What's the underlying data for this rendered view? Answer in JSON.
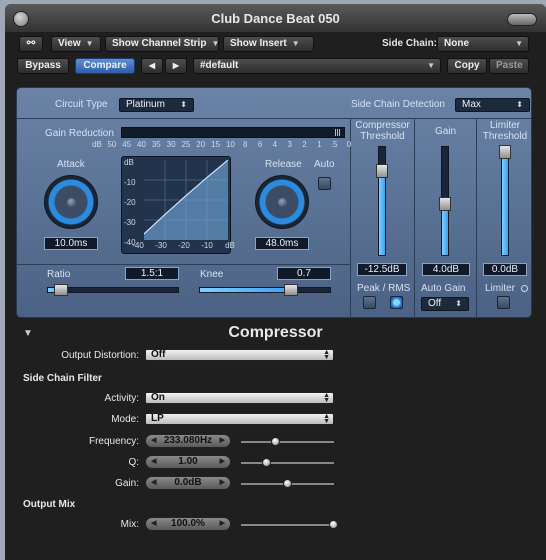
{
  "window": {
    "title": "Club Dance Beat 050"
  },
  "toolbar1": {
    "view": "View",
    "show_channel_strip": "Show Channel Strip",
    "show_insert": "Show Insert",
    "side_chain_label": "Side Chain:",
    "side_chain_value": "None"
  },
  "toolbar2": {
    "bypass": "Bypass",
    "compare": "Compare",
    "prev": "◀",
    "next": "▶",
    "preset": "#default",
    "copy": "Copy",
    "paste": "Paste"
  },
  "plugin": {
    "circuit_type_label": "Circuit Type",
    "circuit_type": "Platinum",
    "side_chain_detection_label": "Side Chain Detection",
    "side_chain_detection": "Max",
    "gain_reduction_label": "Gain Reduction",
    "gain_reduction_scale": [
      "dB",
      "50",
      "45",
      "40",
      "35",
      "30",
      "25",
      "20",
      "15",
      "10",
      "8",
      "6",
      "4",
      "3",
      "2",
      "1",
      ".5",
      "0"
    ],
    "attack_label": "Attack",
    "attack_value": "10.0ms",
    "release_label": "Release",
    "release_value": "48.0ms",
    "auto_label": "Auto",
    "graph_y_labels": [
      "dB",
      "-10",
      "-20",
      "-30",
      "-40"
    ],
    "graph_x_labels": [
      "-40",
      "-30",
      "-20",
      "-10",
      "dB"
    ],
    "ratio_label": "Ratio",
    "ratio_value": "1.5:1",
    "ratio_level": 0.1,
    "knee_label": "Knee",
    "knee_value": "0.7",
    "knee_level": 0.7,
    "compressor_threshold_label": [
      "Compressor",
      "Threshold"
    ],
    "compressor_threshold_value": "-12.5dB",
    "compressor_threshold_level": 0.78,
    "gain_label": "Gain",
    "gain_value": "4.0dB",
    "gain_level": 0.47,
    "limiter_threshold_label": [
      "Limiter",
      "Threshold"
    ],
    "limiter_threshold_value": "0.0dB",
    "limiter_threshold_level": 0.99,
    "peak_rms_label": "Peak / RMS",
    "auto_gain_label": "Auto Gain",
    "auto_gain_value": "Off",
    "limiter_label": "Limiter"
  },
  "extended": {
    "heading": "Compressor",
    "output_distortion_label": "Output Distortion:",
    "output_distortion": "Off",
    "side_chain_filter_heading": "Side Chain Filter",
    "activity_label": "Activity:",
    "activity": "On",
    "mode_label": "Mode:",
    "mode": "LP",
    "frequency_label": "Frequency:",
    "frequency": "233.080Hz",
    "frequency_level": 0.38,
    "q_label": "Q:",
    "q": "1.00",
    "q_level": 0.28,
    "gain_label": "Gain:",
    "gain": "0.0dB",
    "gain_level": 0.5,
    "output_mix_heading": "Output Mix",
    "mix_label": "Mix:",
    "mix": "100.0%",
    "mix_level": 1.0
  },
  "colors": {
    "accent": "#3d9df0",
    "panel": "#5a7396",
    "window": "#1f1f1f"
  }
}
